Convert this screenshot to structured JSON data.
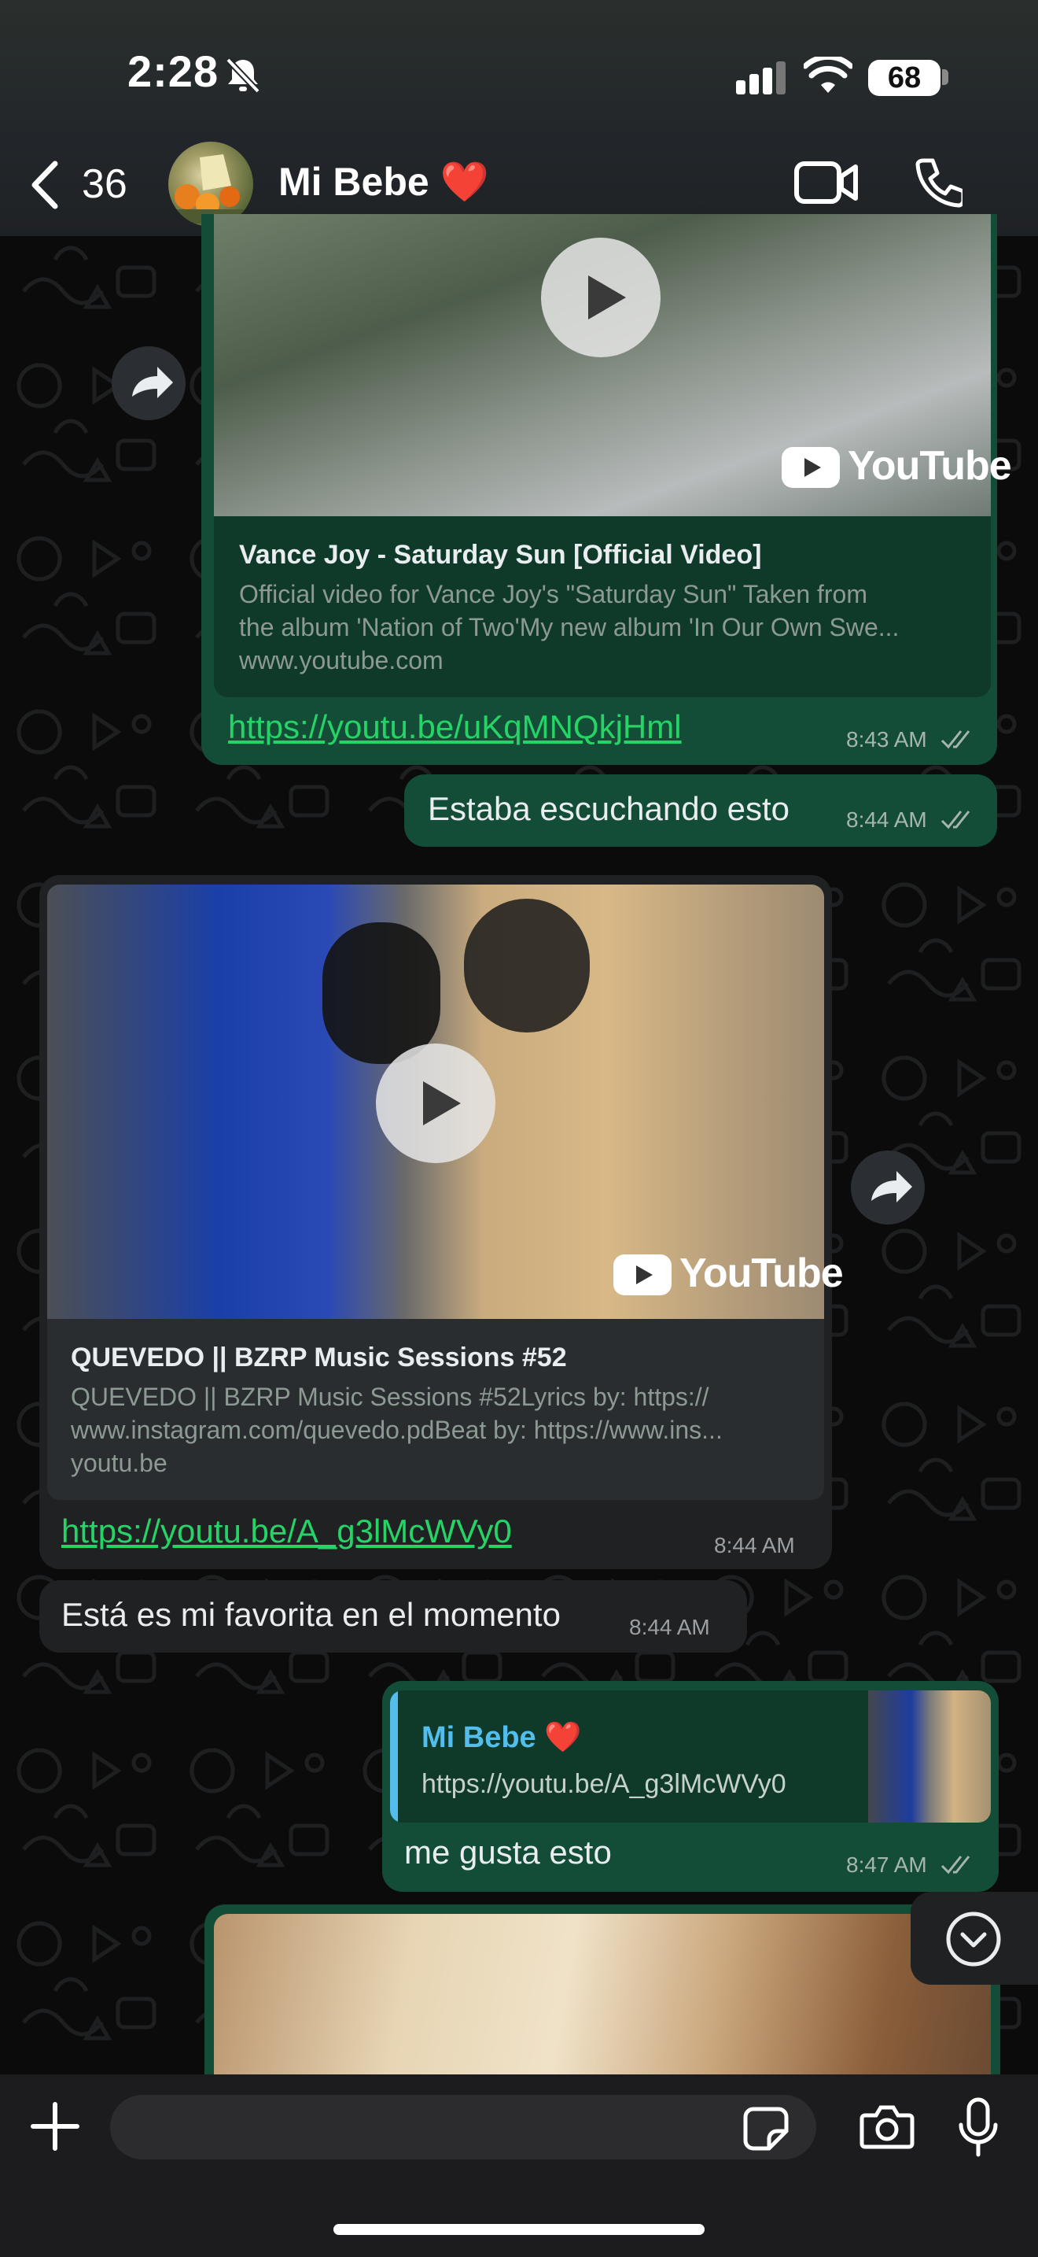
{
  "status": {
    "time": "2:28",
    "battery": "68"
  },
  "header": {
    "back_count": "36",
    "contact_name": "Mi Bebe ❤️"
  },
  "messages": {
    "m1": {
      "preview_title": "Vance Joy - Saturday Sun [Official Video]",
      "preview_desc1": "Official video for Vance Joy's \"Saturday Sun\" Taken from",
      "preview_desc2": "the album 'Nation of Two'My new album 'In Our Own Swe...",
      "preview_site": "www.youtube.com",
      "link": "https://youtu.be/uKqMNQkjHml",
      "time": "8:43 AM",
      "yt_label": "YouTube"
    },
    "m2": {
      "text": "Estaba escuchando esto",
      "time": "8:44 AM"
    },
    "m3": {
      "preview_title": "QUEVEDO || BZRP Music Sessions #52",
      "preview_desc1": "QUEVEDO || BZRP Music Sessions #52Lyrics by: https://",
      "preview_desc2": "www.instagram.com/quevedo.pdBeat by: https://www.ins...",
      "preview_site": "youtu.be",
      "link": "https://youtu.be/A_g3lMcWVy0",
      "time": "8:44 AM",
      "yt_label": "YouTube"
    },
    "m4": {
      "text": "Está es mi favorita en el momento",
      "time": "8:44 AM"
    },
    "m5": {
      "quote_author": "Mi Bebe ❤️",
      "quote_text": "https://youtu.be/A_g3lMcWVy0",
      "text": "me gusta esto",
      "time": "8:47 AM"
    }
  },
  "icons": [
    "back-chevron-icon",
    "muted-bell-icon",
    "signal-icon",
    "wifi-icon",
    "video-call-icon",
    "phone-icon",
    "forward-icon",
    "play-icon",
    "read-receipt-icon",
    "scroll-down-icon",
    "plus-icon",
    "sticker-icon",
    "camera-icon",
    "microphone-icon"
  ],
  "colors": {
    "outgoing": "#134d37",
    "incoming": "#1f2123",
    "link": "#25d366",
    "quote_author": "#53bdeb"
  }
}
